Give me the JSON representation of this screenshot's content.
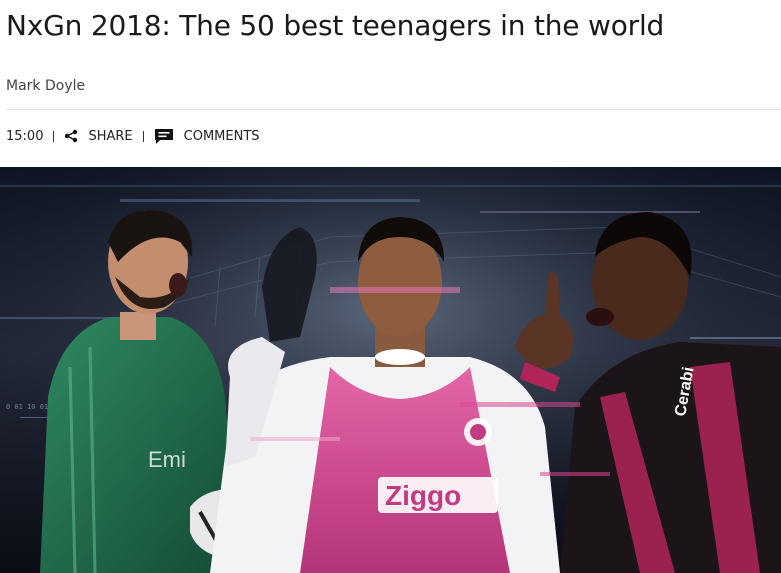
{
  "article": {
    "title": "NxGn 2018: The 50 best teenagers in the world",
    "author": "Mark Doyle"
  },
  "meta": {
    "time": "15:00",
    "share_label": "SHARE",
    "comments_label": "COMMENTS"
  },
  "hero": {
    "left_shirt_text": "Emi",
    "center_shirt_text": "Ziggo",
    "right_shirt_text": "Cerabi",
    "binary_text": "0 01 10 01 10"
  },
  "colors": {
    "headline": "#1a1a1a",
    "accent_pink": "#d9478f",
    "keeper_green": "#1f6b4a"
  },
  "icons": [
    "share-icon",
    "comments-icon"
  ]
}
